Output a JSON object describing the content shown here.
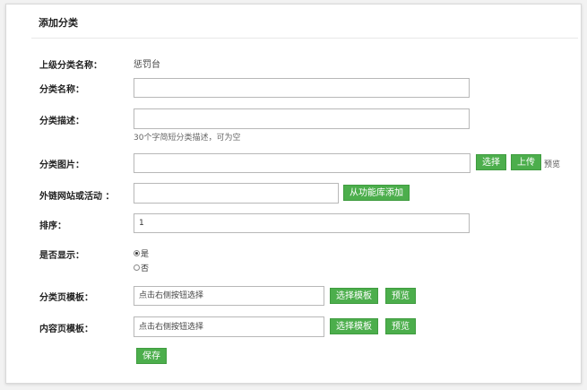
{
  "title": "添加分类",
  "form": {
    "parent": {
      "label": "上级分类名称：",
      "value": "惩罚台"
    },
    "name": {
      "label": "分类名称：",
      "value": "",
      "placeholder": ""
    },
    "description": {
      "label": "分类描述：",
      "value": "",
      "hint": "30个字简短分类描述，可为空"
    },
    "image": {
      "label": "分类图片：",
      "value": "",
      "select_label": "选择",
      "upload_label": "上传",
      "preview_label": "预览"
    },
    "external_link": {
      "label": "外链网站或活动 ：",
      "value": "",
      "add_from_library_label": "从功能库添加"
    },
    "sort": {
      "label": "排序：",
      "value": "1"
    },
    "visible": {
      "label": "是否显示：",
      "options": [
        {
          "label": "是",
          "checked": true
        },
        {
          "label": "否",
          "checked": false
        }
      ]
    },
    "category_template": {
      "label": "分类页模板：",
      "placeholder": "点击右侧按钮选择",
      "select_label": "选择模板",
      "preview_label": "预览"
    },
    "content_template": {
      "label": "内容页模板：",
      "placeholder": "点击右侧按钮选择",
      "select_label": "选择模板",
      "preview_label": "预览"
    },
    "save_label": "保存"
  },
  "colors": {
    "accent": "#4cae4c",
    "background": "#f2f2f2",
    "panel": "#ffffff"
  }
}
